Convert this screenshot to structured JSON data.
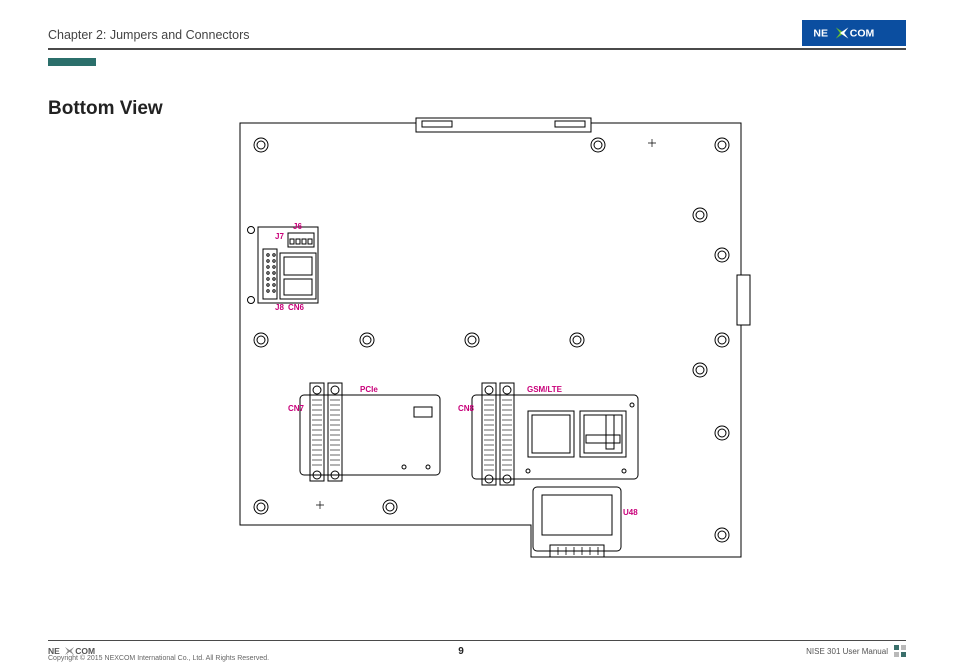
{
  "header": {
    "chapter": "Chapter 2: Jumpers and Connectors",
    "brand": "NEXCOM"
  },
  "title": "Bottom View",
  "labels": {
    "j6": "J6",
    "j7": "J7",
    "j8": "J8",
    "cn6": "CN6",
    "pcie": "PCIe",
    "cn7": "CN7",
    "gsm": "GSM/LTE",
    "cn8": "CN8",
    "u48": "U48"
  },
  "footer": {
    "copyright": "Copyright © 2015 NEXCOM International Co., Ltd. All Rights Reserved.",
    "page": "9",
    "doc": "NISE 301 User Manual"
  }
}
